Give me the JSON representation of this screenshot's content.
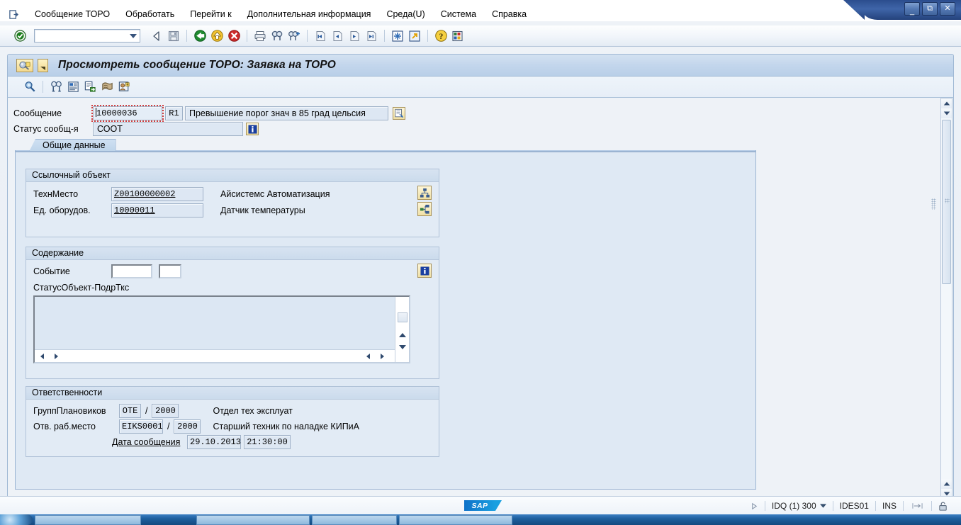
{
  "window": {
    "minimize_label": "_",
    "restore_label": "❐",
    "close_label": "✕"
  },
  "menu": {
    "system_icon": "system-menu-icon",
    "items": [
      {
        "label": "Сообщение ТОРО",
        "accel": "б"
      },
      {
        "label": "Обработать",
        "accel": "О"
      },
      {
        "label": "Перейти к",
        "accel": "П"
      },
      {
        "label": "Дополнительная информация",
        "accel": "Д"
      },
      {
        "label": "Среда(U)",
        "accel": "U"
      },
      {
        "label": "Система",
        "accel": "и"
      },
      {
        "label": "Справка",
        "accel": "С"
      }
    ]
  },
  "toolbar": {
    "enter_icon": "enter-check-icon",
    "command_field_value": "",
    "command_field_placeholder": "",
    "dropdown_icon": "chevron-down-icon",
    "buttons": [
      {
        "name": "back-icon",
        "title": "Назад"
      },
      {
        "name": "save-icon",
        "title": "Сохранить"
      },
      {
        "name": "exit-icon",
        "title": "Выход"
      },
      {
        "name": "cancel-icon",
        "title": "Отменить"
      },
      {
        "name": "end-session-icon",
        "title": "Завершить"
      },
      {
        "name": "print-icon",
        "title": "Печать"
      },
      {
        "name": "find-icon",
        "title": "Найти"
      },
      {
        "name": "find-next-icon",
        "title": "Найти далее"
      },
      {
        "name": "first-page-icon",
        "title": "Первая страница"
      },
      {
        "name": "previous-page-icon",
        "title": "Предыдущая страница"
      },
      {
        "name": "next-page-icon",
        "title": "Следующая страница"
      },
      {
        "name": "last-page-icon",
        "title": "Последняя страница"
      },
      {
        "name": "create-session-icon",
        "title": "Новый сеанс"
      },
      {
        "name": "create-shortcut-icon",
        "title": "Ярлык"
      },
      {
        "name": "help-icon",
        "title": "Справка"
      },
      {
        "name": "customize-layout-icon",
        "title": "Настройка"
      }
    ]
  },
  "app_title": {
    "icon": "notification-badge-icon",
    "menu_icon": "title-menu-icon",
    "text": "Просмотреть сообщение ТОРО: Заявка на ТОРО"
  },
  "app_toolbar": {
    "buttons": [
      {
        "name": "display-change-icon",
        "title": "Просмотреть"
      },
      {
        "name": "objects-icon",
        "title": "Объекты"
      },
      {
        "name": "long-text-icon",
        "title": "Длинный текст"
      },
      {
        "name": "order-icon",
        "title": "Заказ"
      },
      {
        "name": "history-icon",
        "title": "История"
      },
      {
        "name": "partner-icon",
        "title": "Партнёры"
      }
    ]
  },
  "header": {
    "message_label": "Сообщение",
    "message_number": "10000036",
    "message_type": "R1",
    "message_text": "Превышение порог знач в 85 град цельсия",
    "long_text_icon": "long-text-icon",
    "status_label": "Статус сообщ-я",
    "status_value": "СООТ",
    "status_info_icon": "info-icon"
  },
  "tabs": [
    {
      "label": "Общие данные",
      "active": true
    }
  ],
  "groups": {
    "reference_object": {
      "title": "Ссылочный объект",
      "rows": [
        {
          "label": "ТехнМесто",
          "value": "Z00100000002",
          "description": "Айсистемс Автоматизация",
          "icon": "structure-hierarchy-icon"
        },
        {
          "label": "Ед. оборудов.",
          "value": "10000011",
          "description": "Датчик температуры",
          "icon": "equipment-structure-icon"
        }
      ]
    },
    "content": {
      "title": "Содержание",
      "event_label": "Событие",
      "event_code": "",
      "event_value": "",
      "info_icon": "info-icon",
      "subtext_label": "СтатусОбъект-ПодрТкс",
      "textarea_value": ""
    },
    "responsibilities": {
      "title": "Ответственности",
      "rows": [
        {
          "label": "ГруппПлановиков",
          "value": "OTE",
          "separator": "/",
          "plant": "2000",
          "description": "Отдел тех эксплуат"
        },
        {
          "label": "Отв. раб.место",
          "value": "EIKS0001",
          "separator": "/",
          "plant": "2000",
          "description": "Старший техник по наладке КИПиА"
        }
      ],
      "date_label": "Дата сообщения",
      "date_value": "29.10.2013",
      "time_value": "21:30:00"
    }
  },
  "status_bar": {
    "logo": "SAP",
    "expand_icon": "expand-triangle-icon",
    "system": "IDQ (1) 300",
    "system_dropdown_icon": "chevron-down-icon",
    "server": "IDES01",
    "insert_mode": "INS",
    "resize_icon": "resize-icon",
    "lock_icon": "unlock-icon"
  },
  "colors": {
    "title_gradient_start": "#d3e1f1",
    "field_bg": "#dce7f3",
    "panel_bg": "#dfe9f4",
    "group_bg": "#e2ebf5",
    "focus_red": "#d04040",
    "sap_blue": "#0e71c8",
    "taskbar_blue": "#1e5f9e"
  }
}
